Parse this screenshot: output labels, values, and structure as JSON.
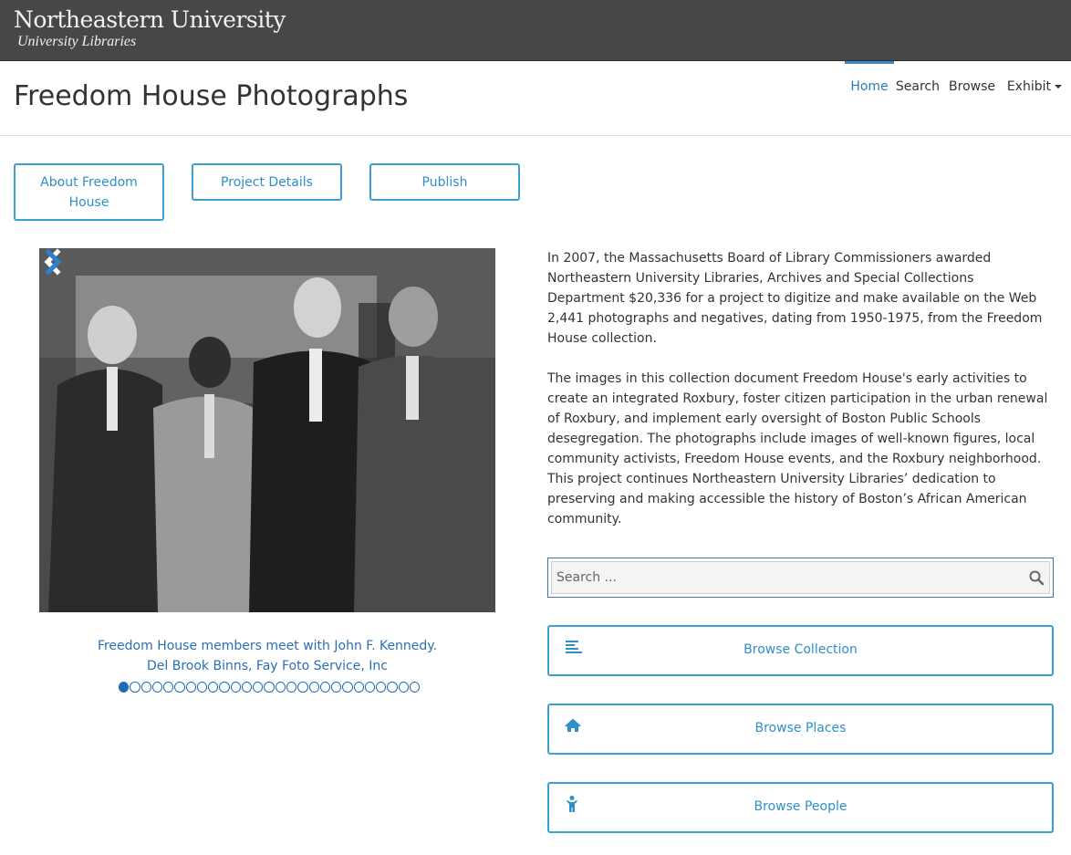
{
  "header": {
    "brand_name": "Northeastern University",
    "brand_sub": "University Libraries"
  },
  "page": {
    "title": "Freedom House Photographs"
  },
  "nav": {
    "items": [
      {
        "label": "Home",
        "active": true
      },
      {
        "label": "Search"
      },
      {
        "label": "Browse"
      },
      {
        "label": "Exhibit"
      }
    ]
  },
  "buttons": {
    "about": "About Freedom House",
    "project": "Project Details",
    "publish": "Publish"
  },
  "carousel": {
    "caption_line1": "Freedom House members meet with John F. Kennedy.",
    "caption_line2": "Del Brook Binns, Fay Foto Service, Inc",
    "slide_count": 27,
    "active_index": 0
  },
  "description": {
    "p1": "In 2007, the  Massachusetts Board  of Library Commissioners awarded Northeastern University Libraries, Archives and Special Collections Department $20,336  for a  project to digitize  and make available on the Web 2,441 photographs and negatives, dating from 1950-1975, from the Freedom House collection.",
    "p2": "The images in this collection document Freedom House's early activities to create an integrated Roxbury, foster citizen participation in the urban renewal of Roxbury, and implement early oversight of Boston Public  Schools desegregation. The photographs include images of well-known figures, local community activists, Freedom House  events, and the Roxbury neighborhood. This project  continues Northeastern University Libraries’ dedication to preserving and making accessible the history of Boston’s African American community."
  },
  "search": {
    "placeholder": "Search ..."
  },
  "browse": {
    "collection": {
      "label": "Browse Collection",
      "icon": "list-icon"
    },
    "places": {
      "label": "Browse Places",
      "icon": "home-icon"
    },
    "people": {
      "label": "Browse People",
      "icon": "person-icon"
    }
  },
  "colors": {
    "topbar": "#474747",
    "accent": "#3ba0cf",
    "link": "#2a6fb3"
  }
}
